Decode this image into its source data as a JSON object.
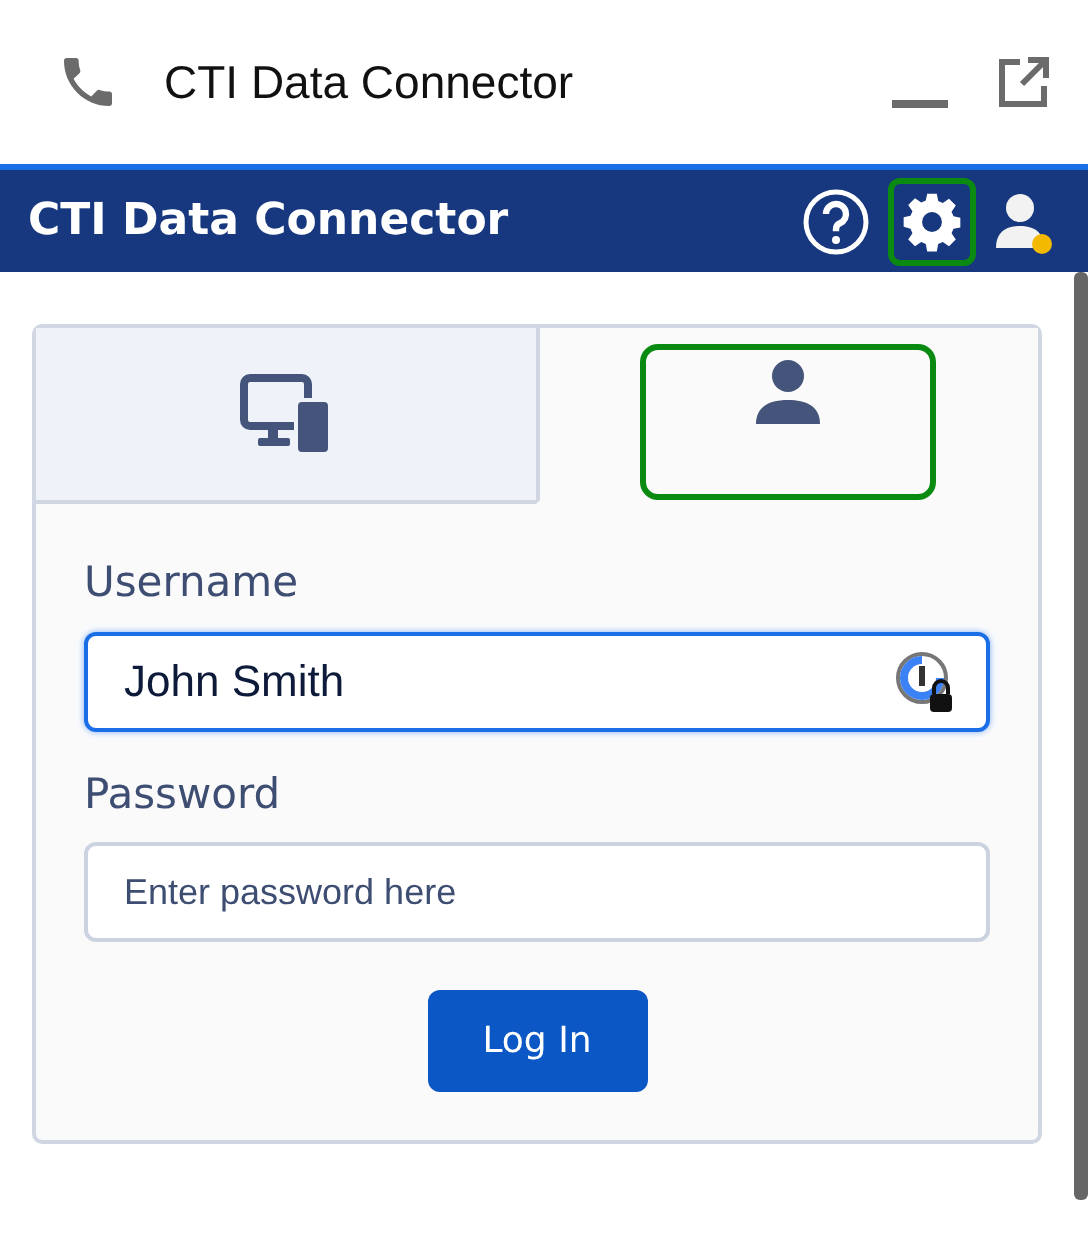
{
  "window": {
    "title": "CTI Data Connector"
  },
  "header": {
    "title": "CTI Data Connector",
    "icons": [
      {
        "kind": "help",
        "highlighted": false
      },
      {
        "kind": "settings",
        "highlighted": true
      },
      {
        "kind": "user",
        "highlighted": false
      }
    ]
  },
  "tabs": [
    {
      "kind": "devices",
      "selected": false,
      "highlighted": false
    },
    {
      "kind": "user",
      "selected": true,
      "highlighted": true
    }
  ],
  "form": {
    "fields": [
      {
        "label": "Username",
        "value": "John Smith",
        "focused": true
      },
      {
        "label": "Password",
        "placeholder": "Enter password here",
        "focused": false
      }
    ],
    "button": "Log In"
  }
}
